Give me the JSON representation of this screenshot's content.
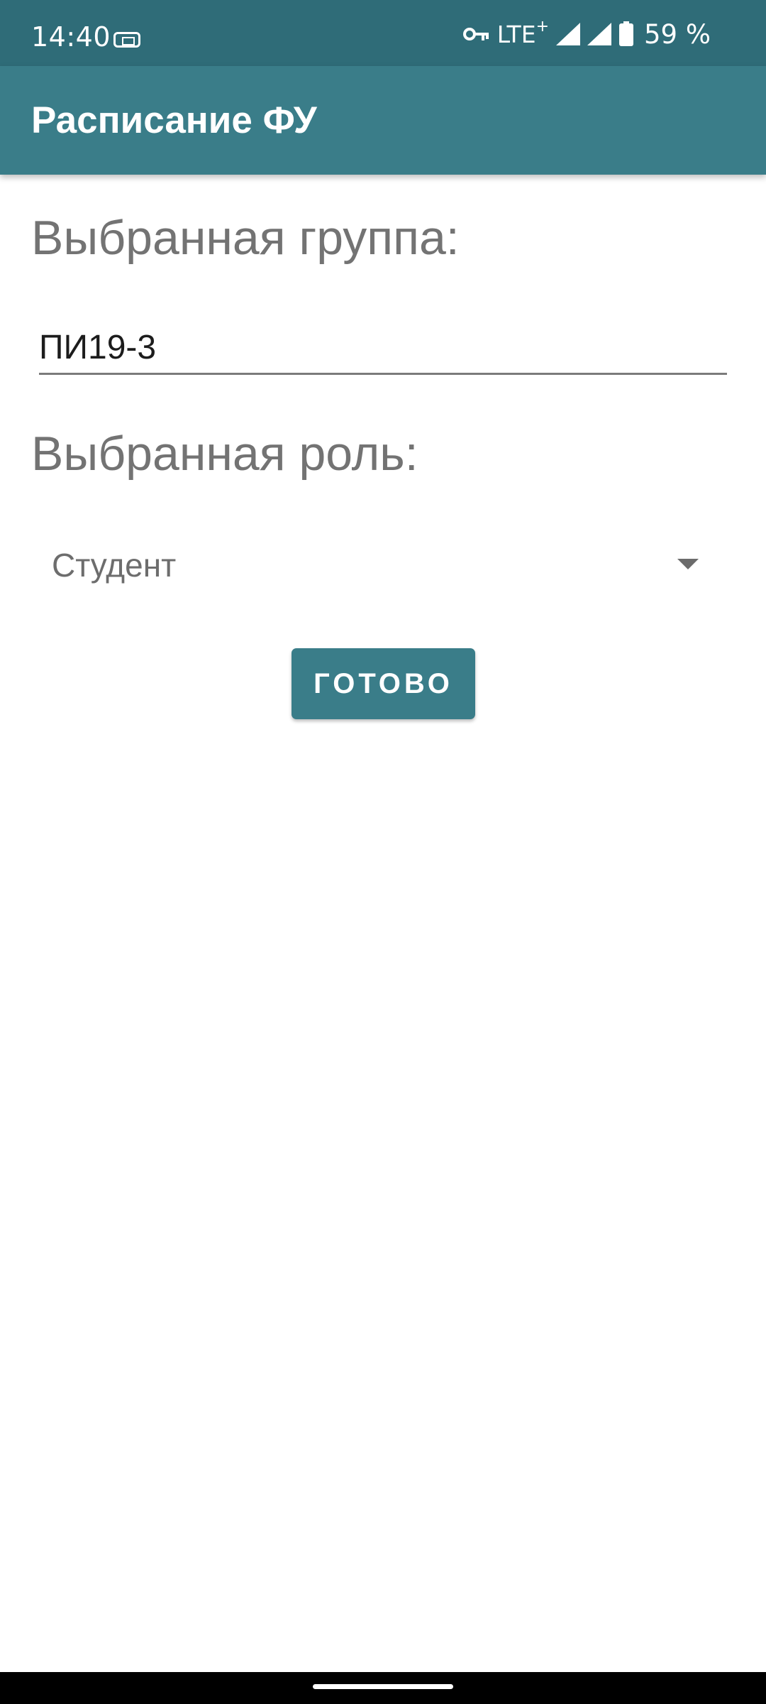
{
  "status_bar": {
    "time": "14:40",
    "network": "LTE",
    "network_plus": "+",
    "battery": "59 %",
    "icons": [
      "sim-icon",
      "vpn-key-icon",
      "signal-icon",
      "signal-icon",
      "battery-icon"
    ]
  },
  "app_bar": {
    "title": "Расписание ФУ"
  },
  "form": {
    "group_label": "Выбранная группа:",
    "group_value": "ПИ19-3",
    "role_label": "Выбранная роль:",
    "role_value": "Студент",
    "done_label": "ГОТОВО"
  },
  "colors": {
    "status_bar": "#2f6c78",
    "primary": "#3a7d89",
    "label_text": "#737373"
  }
}
